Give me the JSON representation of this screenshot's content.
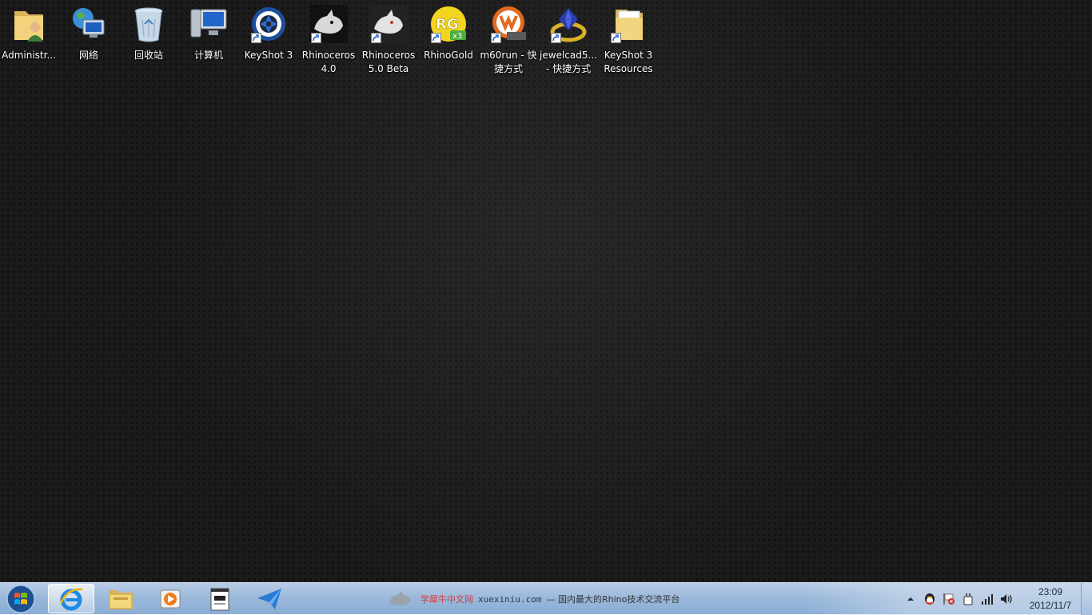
{
  "desktop": {
    "icons": [
      {
        "name": "administrator-folder",
        "label": "Administr...",
        "shortcut": false
      },
      {
        "name": "network",
        "label": "网络",
        "shortcut": false
      },
      {
        "name": "recycle-bin",
        "label": "回收站",
        "shortcut": false
      },
      {
        "name": "computer",
        "label": "计算机",
        "shortcut": false
      },
      {
        "name": "keyshot-3",
        "label": "KeyShot 3",
        "shortcut": true
      },
      {
        "name": "rhinoceros-4",
        "label": "Rhinoceros 4.0",
        "shortcut": true
      },
      {
        "name": "rhinoceros-5-beta",
        "label": "Rhinoceros 5.0 Beta",
        "shortcut": true
      },
      {
        "name": "rhinogold",
        "label": "RhinoGold",
        "shortcut": true
      },
      {
        "name": "m60run",
        "label": "m60run - 快捷方式",
        "shortcut": true
      },
      {
        "name": "jewelcad5",
        "label": "jewelcad5... - 快捷方式",
        "shortcut": true
      },
      {
        "name": "keyshot-3-resources",
        "label": "KeyShot 3 Resources",
        "shortcut": true
      }
    ]
  },
  "taskbar": {
    "banner": {
      "site_cn": "学犀牛中文网",
      "site_url": "xuexiniu.com",
      "slogan": "— 国内最大的Rhino技术交流平台"
    },
    "clock": {
      "time": "23:09",
      "date": "2012/11/7"
    }
  },
  "colors": {
    "desktop_bg": "#1b1b1b",
    "taskbar_bg": "#99b7d9"
  }
}
